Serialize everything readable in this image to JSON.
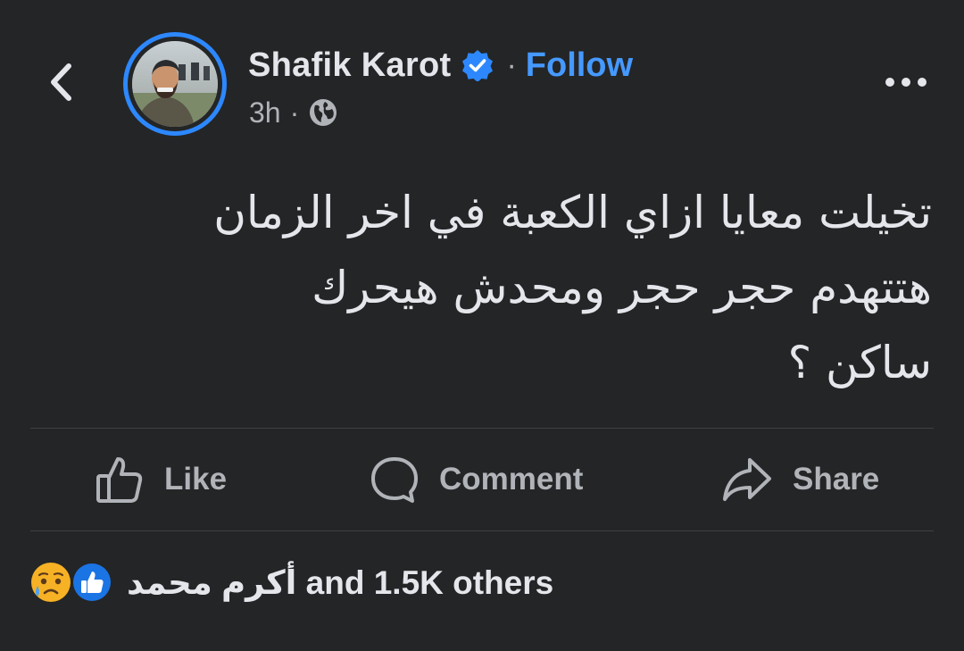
{
  "author": {
    "name": "Shafik Karot",
    "verified": true,
    "follow_label": "Follow",
    "separator": "·"
  },
  "meta": {
    "time": "3h",
    "separator": "·",
    "audience_icon": "globe-icon"
  },
  "header": {
    "back_icon": "chevron-left-icon",
    "more_icon": "more-horizontal-icon"
  },
  "post": {
    "lines": [
      "تخيلت معايا ازاي الكعبة في اخر الزمان",
      "هتتهدم حجر حجر ومحدش هيحرك",
      "ساكن ؟"
    ]
  },
  "actions": {
    "like_label": "Like",
    "comment_label": "Comment",
    "share_label": "Share"
  },
  "reactions": {
    "icons": [
      "sad-reaction-icon",
      "like-reaction-icon"
    ],
    "summary": "أكرم محمد and 1.5K others"
  },
  "colors": {
    "background": "#242526",
    "accent": "#2d88ff",
    "follow": "#4599ff",
    "text": "#e4e6eb",
    "muted": "#b0b3b8"
  }
}
